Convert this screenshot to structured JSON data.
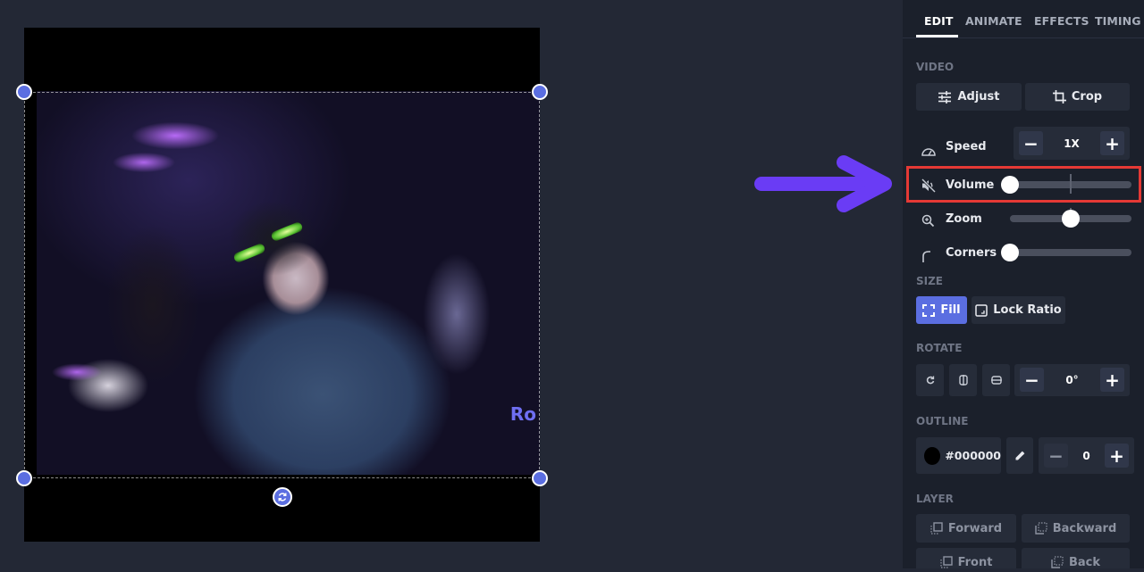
{
  "canvas": {
    "video_overlay_text": "Ro",
    "handles": [
      "top-left",
      "top-right",
      "bottom-left",
      "bottom-right"
    ]
  },
  "annotation": {
    "arrow_color": "#6a3cf5",
    "highlight_color": "#e53935",
    "highlight_target": "Volume"
  },
  "tabs": [
    {
      "label": "EDIT",
      "active": true
    },
    {
      "label": "ANIMATE",
      "active": false
    },
    {
      "label": "EFFECTS",
      "active": false
    },
    {
      "label": "TIMING",
      "active": false
    }
  ],
  "video": {
    "section_label": "VIDEO",
    "adjust_label": "Adjust",
    "crop_label": "Crop",
    "speed": {
      "label": "Speed",
      "value": "1X",
      "minus": "−",
      "plus": "+"
    },
    "volume": {
      "label": "Volume",
      "muted": true,
      "value_pct": 0
    },
    "zoom": {
      "label": "Zoom",
      "value_pct": 50
    },
    "corners": {
      "label": "Corners",
      "value_pct": 0
    }
  },
  "size": {
    "section_label": "SIZE",
    "fill_label": "Fill",
    "lock_ratio_label": "Lock Ratio"
  },
  "rotate": {
    "section_label": "ROTATE",
    "value": "0°",
    "minus": "−",
    "plus": "+"
  },
  "outline": {
    "section_label": "OUTLINE",
    "color_hex": "#000000",
    "width_value": "0",
    "minus": "−",
    "plus": "+"
  },
  "layer": {
    "section_label": "LAYER",
    "forward_label": "Forward",
    "backward_label": "Backward",
    "front_label": "Front",
    "back_label": "Back"
  },
  "colors": {
    "accent": "#5b6ee1",
    "panel_bg": "#1b202b",
    "app_bg": "#232835"
  }
}
